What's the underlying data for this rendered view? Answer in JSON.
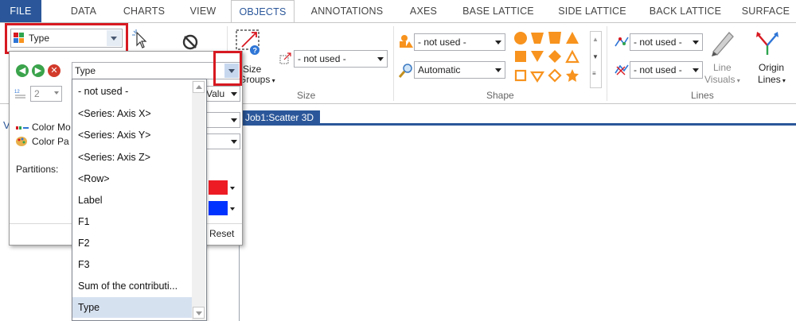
{
  "menu": {
    "tabs": [
      "FILE",
      "DATA",
      "CHARTS",
      "VIEW",
      "OBJECTS",
      "ANNOTATIONS",
      "AXES",
      "BASE LATTICE",
      "SIDE LATTICE",
      "BACK LATTICE",
      "SURFACE"
    ],
    "active": "OBJECTS"
  },
  "ribbon": {
    "type_combo_value": "Type",
    "size_label": "Size",
    "size_groups_label_a": "Size",
    "size_groups_label_b": "Groups",
    "size_combo_value": "- not used -",
    "shape_label": "Shape",
    "shape_combo_value": "- not used -",
    "shape_auto_value": "Automatic",
    "lines_label": "Lines",
    "lines_combo1_value": "- not used -",
    "lines_combo2_value": "- not used -",
    "line_visuals_a": "Line",
    "line_visuals_b": "Visuals",
    "origin_lines_a": "Origin",
    "origin_lines_b": "Lines"
  },
  "panel": {
    "type_field_value": "Type",
    "spin_value": "2",
    "value_combo_text": "Valu",
    "color_mode_label": "Color Mo",
    "color_palette_label": "Color Pa",
    "partitions_label": "Partitions:",
    "reset_label": "Reset",
    "swatch1": "#ed1c24",
    "swatch2": "#0033ff"
  },
  "dropdown": {
    "items": [
      "- not used -",
      "<Series: Axis X>",
      "<Series: Axis Y>",
      "<Series: Axis Z>",
      "<Row>",
      "Label",
      "F1",
      "F2",
      "F3",
      "Sum of the contributi...",
      "Type"
    ],
    "selected": "Type"
  },
  "document_tab": "Job1:Scatter 3D",
  "workspace_letter": "V",
  "colors": {
    "file_tab": "#2b579a",
    "accent": "#2b579a",
    "highlight_red": "#d71921",
    "shape_orange": "#f7931e"
  }
}
